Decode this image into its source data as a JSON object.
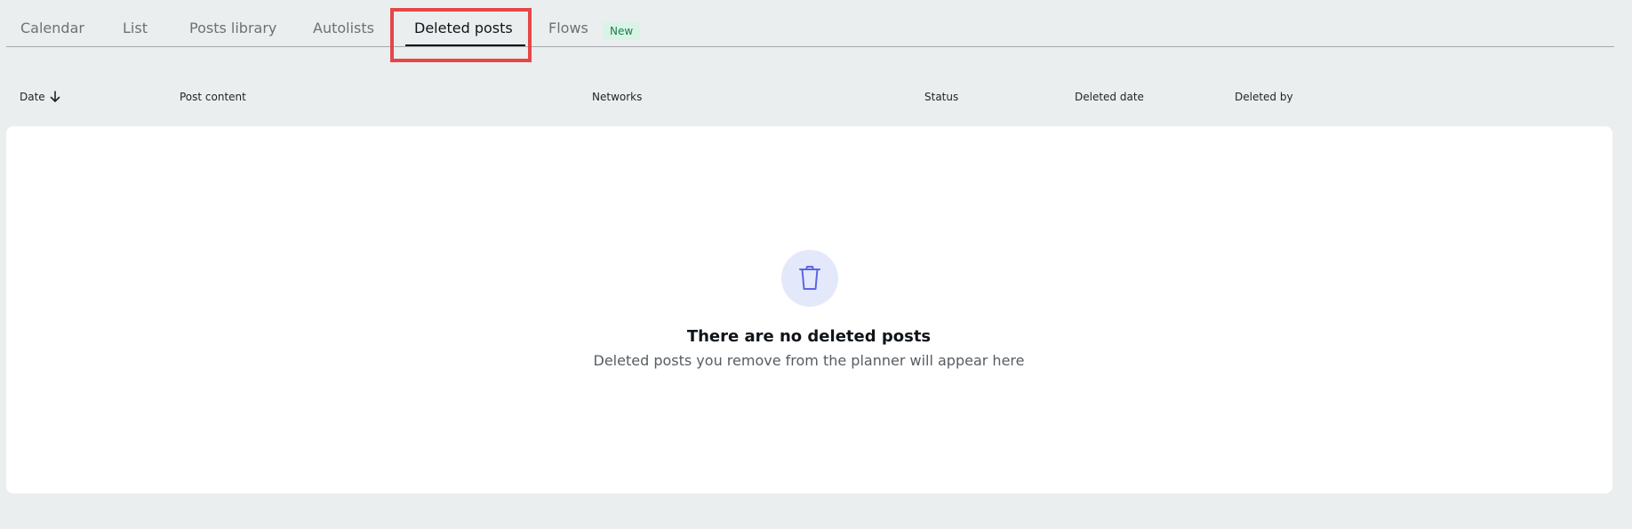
{
  "tabs": [
    {
      "label": "Calendar"
    },
    {
      "label": "List"
    },
    {
      "label": "Posts library"
    },
    {
      "label": "Autolists"
    },
    {
      "label": "Deleted posts",
      "active": true
    },
    {
      "label": "Flows",
      "badge": "New"
    }
  ],
  "table": {
    "columns": [
      "Date",
      "Post content",
      "Networks",
      "Status",
      "Deleted date",
      "Deleted by"
    ],
    "sort": {
      "column": "Date",
      "direction": "down",
      "icon": "arrow-down-icon"
    }
  },
  "empty_state": {
    "icon": "trash-icon",
    "title": "There are no deleted posts",
    "subtitle": "Deleted posts you remove from the planner will appear here"
  },
  "colors": {
    "highlight": "#e54747",
    "icon_accent": "#5b67e3",
    "badge_bg": "#d9f4e6",
    "badge_text": "#1f7a4e"
  }
}
